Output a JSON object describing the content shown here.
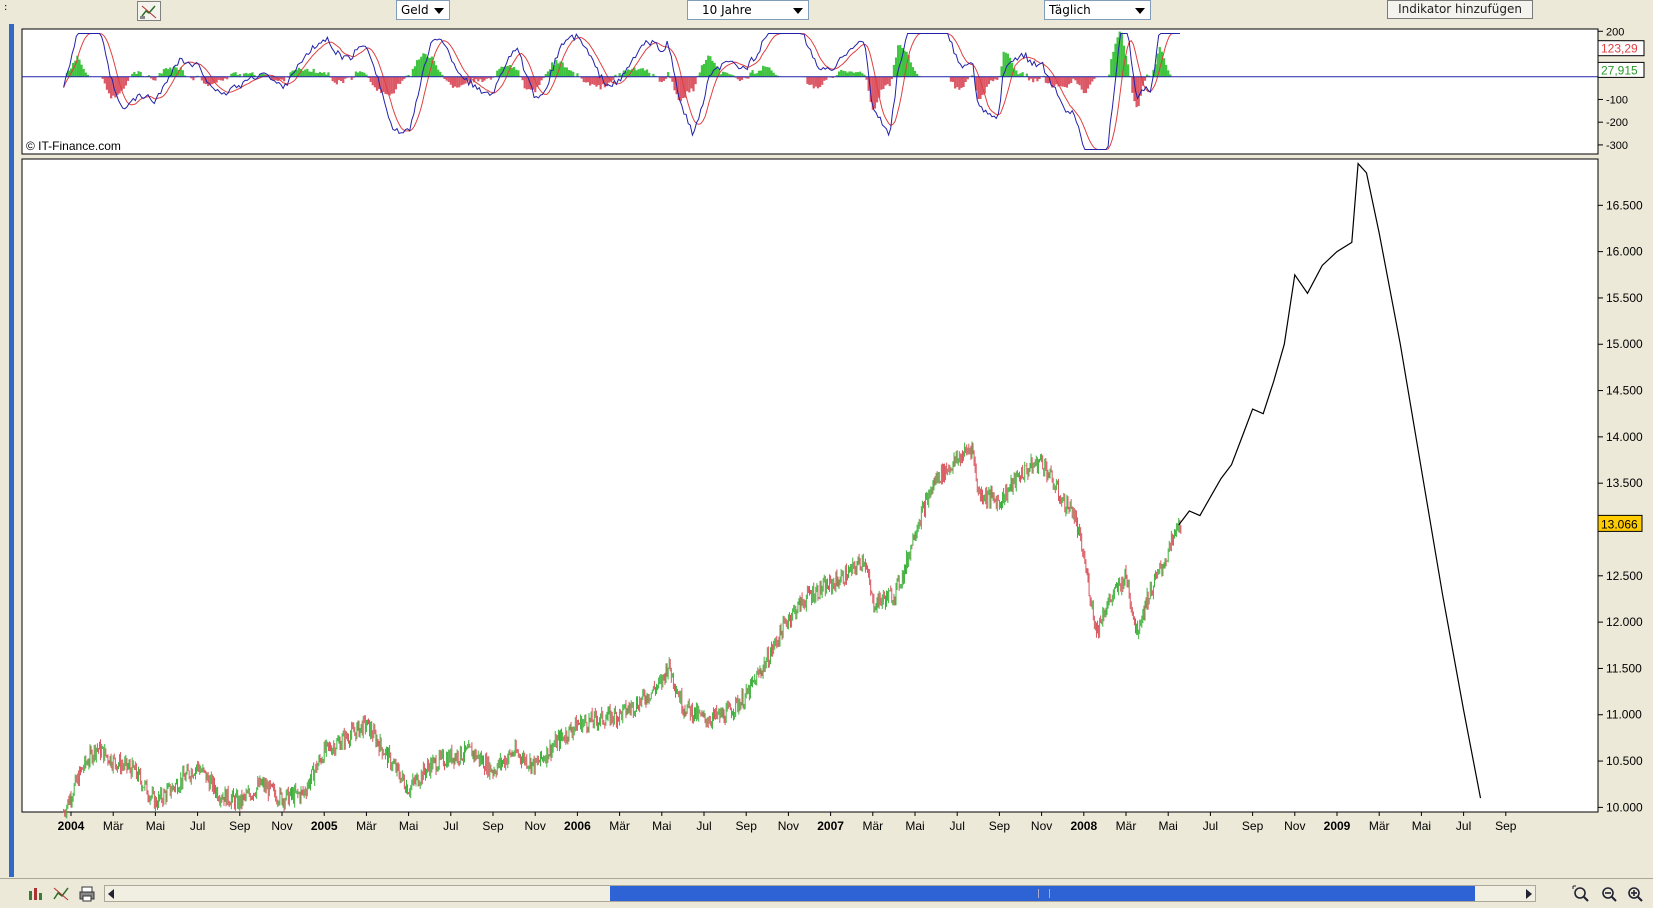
{
  "toolbar": {
    "price_select": "Geld",
    "range_select": "10 Jahre",
    "interval_select": "Täglich",
    "add_indicator": "Indikator hinzufügen",
    "left_mark": ":"
  },
  "copyright": "© IT-Finance.com",
  "colors": {
    "up": "#3cb33c",
    "down": "#d9545d",
    "line": "#000000",
    "macd": "#2222aa",
    "signal": "#e04040",
    "hist_pos": "#3ec43e",
    "hist_neg": "#dd5866",
    "last_badge": "#ffcc00"
  },
  "chart_data": [
    {
      "type": "bar",
      "panel": "indicator",
      "y_ticks": [
        200,
        100,
        0,
        -100,
        -200,
        -300
      ],
      "y_tick_labels": [
        "200",
        "",
        "",
        "-100",
        "-200",
        "-300"
      ],
      "ylim": [
        -340,
        210
      ],
      "value_labels": [
        "123,29",
        "27,915"
      ],
      "values_shown": [
        123.29,
        27.915
      ]
    },
    {
      "type": "line",
      "panel": "price",
      "y_ticks": [
        10000,
        10500,
        11000,
        11500,
        12000,
        12500,
        13000,
        13500,
        14000,
        14500,
        15000,
        15500,
        16000,
        16500
      ],
      "y_tick_labels": [
        "10.000",
        "10.500",
        "11.000",
        "11.500",
        "12.000",
        "12.500",
        "",
        "13.500",
        "14.000",
        "14.500",
        "15.000",
        "15.500",
        "16.000",
        "16.500"
      ],
      "ylim": [
        9950,
        17000
      ],
      "last_value": "13.066",
      "x_ticks": [
        {
          "label": "2004",
          "m": 0,
          "bold": true
        },
        {
          "label": "Mär",
          "m": 2
        },
        {
          "label": "Mai",
          "m": 4
        },
        {
          "label": "Jul",
          "m": 6
        },
        {
          "label": "Sep",
          "m": 8
        },
        {
          "label": "Nov",
          "m": 10
        },
        {
          "label": "2005",
          "m": 12,
          "bold": true
        },
        {
          "label": "Mär",
          "m": 14
        },
        {
          "label": "Mai",
          "m": 16
        },
        {
          "label": "Jul",
          "m": 18
        },
        {
          "label": "Sep",
          "m": 20
        },
        {
          "label": "Nov",
          "m": 22
        },
        {
          "label": "2006",
          "m": 24,
          "bold": true
        },
        {
          "label": "Mär",
          "m": 26
        },
        {
          "label": "Mai",
          "m": 28
        },
        {
          "label": "Jul",
          "m": 30
        },
        {
          "label": "Sep",
          "m": 32
        },
        {
          "label": "Nov",
          "m": 34
        },
        {
          "label": "2007",
          "m": 36,
          "bold": true
        },
        {
          "label": "Mär",
          "m": 38
        },
        {
          "label": "Mai",
          "m": 40
        },
        {
          "label": "Jul",
          "m": 42
        },
        {
          "label": "Sep",
          "m": 44
        },
        {
          "label": "Nov",
          "m": 46
        },
        {
          "label": "2008",
          "m": 48,
          "bold": true
        },
        {
          "label": "Mär",
          "m": 50
        },
        {
          "label": "Mai",
          "m": 52
        },
        {
          "label": "Jul",
          "m": 54
        },
        {
          "label": "Sep",
          "m": 56
        },
        {
          "label": "Nov",
          "m": 58
        },
        {
          "label": "2009",
          "m": 60,
          "bold": true
        },
        {
          "label": "Mär",
          "m": 62
        },
        {
          "label": "Mai",
          "m": 64
        },
        {
          "label": "Jul",
          "m": 66
        },
        {
          "label": "Sep",
          "m": 68
        }
      ],
      "price_series": [
        [
          -0.35,
          9950
        ],
        [
          0.5,
          10400
        ],
        [
          1.2,
          10650
        ],
        [
          2.0,
          10500
        ],
        [
          3.0,
          10400
        ],
        [
          4.0,
          10050
        ],
        [
          5.0,
          10250
        ],
        [
          6.0,
          10450
        ],
        [
          7.0,
          10150
        ],
        [
          8.0,
          10050
        ],
        [
          9.0,
          10250
        ],
        [
          10.0,
          10100
        ],
        [
          11.0,
          10150
        ],
        [
          12.0,
          10600
        ],
        [
          13.0,
          10750
        ],
        [
          14.0,
          10900
        ],
        [
          15.0,
          10550
        ],
        [
          16.0,
          10200
        ],
        [
          17.0,
          10450
        ],
        [
          18.0,
          10550
        ],
        [
          19.0,
          10600
        ],
        [
          20.0,
          10400
        ],
        [
          21.0,
          10600
        ],
        [
          22.0,
          10450
        ],
        [
          23.0,
          10700
        ],
        [
          24.0,
          10900
        ],
        [
          25.0,
          10950
        ],
        [
          26.0,
          11000
        ],
        [
          27.0,
          11150
        ],
        [
          28.0,
          11350
        ],
        [
          28.3,
          11550
        ],
        [
          29.0,
          11100
        ],
        [
          30.0,
          10950
        ],
        [
          31.0,
          11000
        ],
        [
          32.0,
          11200
        ],
        [
          33.0,
          11600
        ],
        [
          34.0,
          12050
        ],
        [
          35.0,
          12300
        ],
        [
          36.0,
          12400
        ],
        [
          37.0,
          12550
        ],
        [
          37.6,
          12700
        ],
        [
          38.0,
          12200
        ],
        [
          39.0,
          12300
        ],
        [
          39.5,
          12550
        ],
        [
          40.0,
          13000
        ],
        [
          41.0,
          13550
        ],
        [
          42.0,
          13750
        ],
        [
          42.7,
          13900
        ],
        [
          43.0,
          13400
        ],
        [
          44.0,
          13300
        ],
        [
          45.0,
          13600
        ],
        [
          46.0,
          13750
        ],
        [
          47.0,
          13300
        ],
        [
          47.5,
          13200
        ],
        [
          48.0,
          12700
        ],
        [
          48.6,
          11900
        ],
        [
          49.0,
          12150
        ],
        [
          50.0,
          12500
        ],
        [
          50.5,
          11900
        ],
        [
          51.0,
          12250
        ],
        [
          52.0,
          12750
        ],
        [
          52.5,
          13050
        ],
        [
          53.0,
          13200
        ],
        [
          53.5,
          13150
        ],
        [
          54.0,
          13350
        ],
        [
          54.5,
          13550
        ],
        [
          55.0,
          13700
        ],
        [
          55.5,
          14000
        ],
        [
          56.0,
          14300
        ],
        [
          56.5,
          14250
        ],
        [
          57.0,
          14600
        ],
        [
          57.5,
          15000
        ],
        [
          58.0,
          15750
        ],
        [
          58.6,
          15550
        ],
        [
          59.3,
          15850
        ],
        [
          60.0,
          16000
        ],
        [
          60.7,
          16100
        ],
        [
          61.0,
          16950
        ],
        [
          61.4,
          16850
        ],
        [
          62.0,
          16200
        ],
        [
          63.0,
          15000
        ],
        [
          64.0,
          13650
        ],
        [
          65.0,
          12300
        ],
        [
          66.0,
          11050
        ],
        [
          66.8,
          10100
        ]
      ]
    }
  ]
}
